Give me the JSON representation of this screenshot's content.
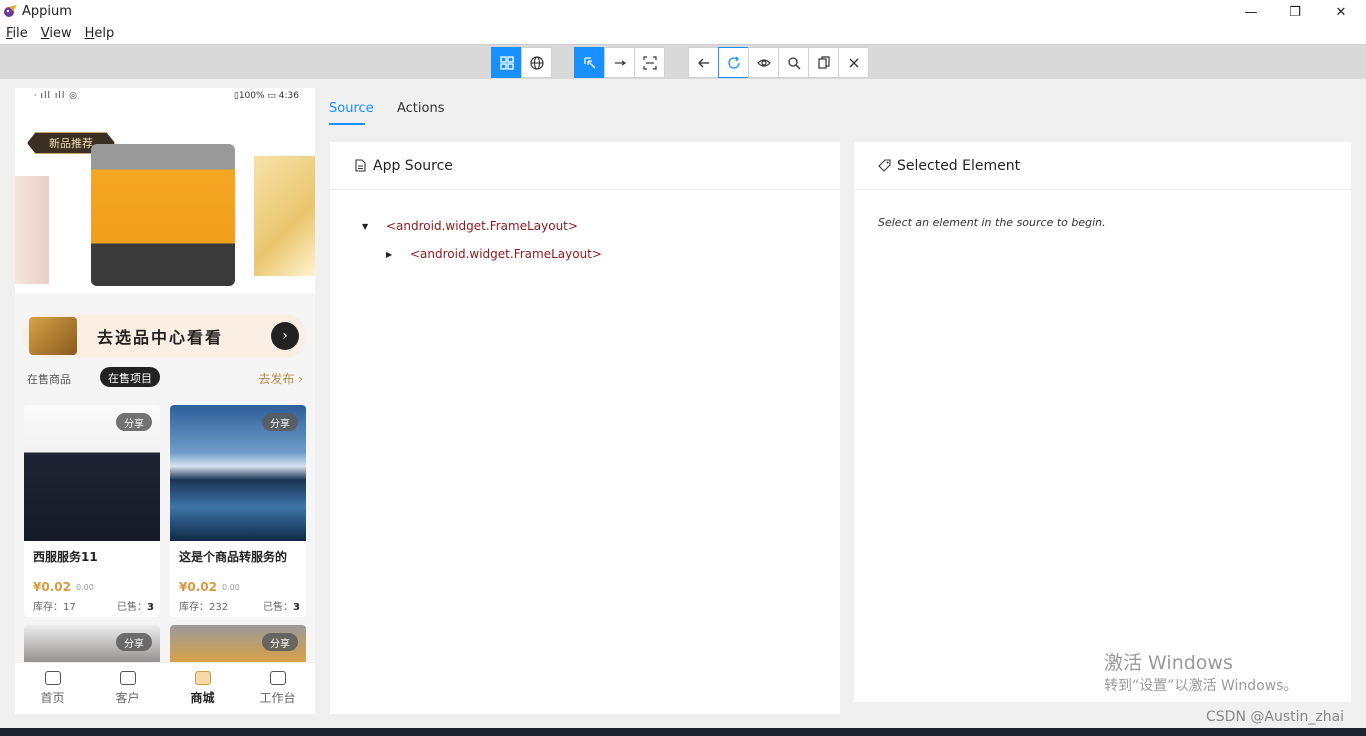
{
  "window": {
    "title": "Appium",
    "controls": {
      "minimize": "—",
      "maximize": "❐",
      "close": "✕"
    }
  },
  "menu": {
    "items": [
      "File",
      "View",
      "Help"
    ]
  },
  "toolbar": {
    "group1": [
      "grid-icon",
      "globe-icon"
    ],
    "group2": [
      "select-icon",
      "swipe-icon",
      "tap-area-icon"
    ],
    "group3": [
      "back-icon",
      "refresh-icon",
      "eye-icon",
      "search-icon",
      "copy-icon",
      "close-icon"
    ]
  },
  "phone": {
    "status_left": " · ıll ıll ◎",
    "status_right": "▯100% ▭ 4:36",
    "banner_tag": "新品推荐",
    "center_banner_text": "去选品中心看看",
    "center_banner_arrow": "›",
    "subtabs": {
      "on_sale_goods": "在售商品",
      "on_sale_projects": "在售项目",
      "publish": "去发布 ›"
    },
    "cards": [
      {
        "share": "分享",
        "name": "西服服务11",
        "price": "¥0.02",
        "old_price": "0.00",
        "stock_label": "库存：17",
        "sold_label": "已售：",
        "sold": "3"
      },
      {
        "share": "分享",
        "name": "这是个商品转服务的",
        "price": "¥0.02",
        "old_price": "0.00",
        "stock_label": "库存：232",
        "sold_label": "已售：",
        "sold": "3"
      },
      {
        "share": "分享"
      },
      {
        "share": "分享"
      }
    ],
    "nav": [
      "首页",
      "客户",
      "商城",
      "工作台"
    ]
  },
  "tabs": {
    "source": "Source",
    "actions": "Actions"
  },
  "app_source": {
    "title": "App Source",
    "nodes": [
      {
        "caret": "▼",
        "text": "<android.widget.FrameLayout>"
      },
      {
        "caret": "▶",
        "text": "<android.widget.FrameLayout>"
      }
    ]
  },
  "selected_element": {
    "title": "Selected Element",
    "hint": "Select an element in the source to begin."
  },
  "watermark": {
    "line1": "激活 Windows",
    "line2": "转到“设置”以激活 Windows。"
  },
  "csdn": "CSDN @Austin_zhai",
  "colors": {
    "accent": "#1890ff",
    "tree_text": "#8b1a1a",
    "price": "#d39a3f"
  }
}
